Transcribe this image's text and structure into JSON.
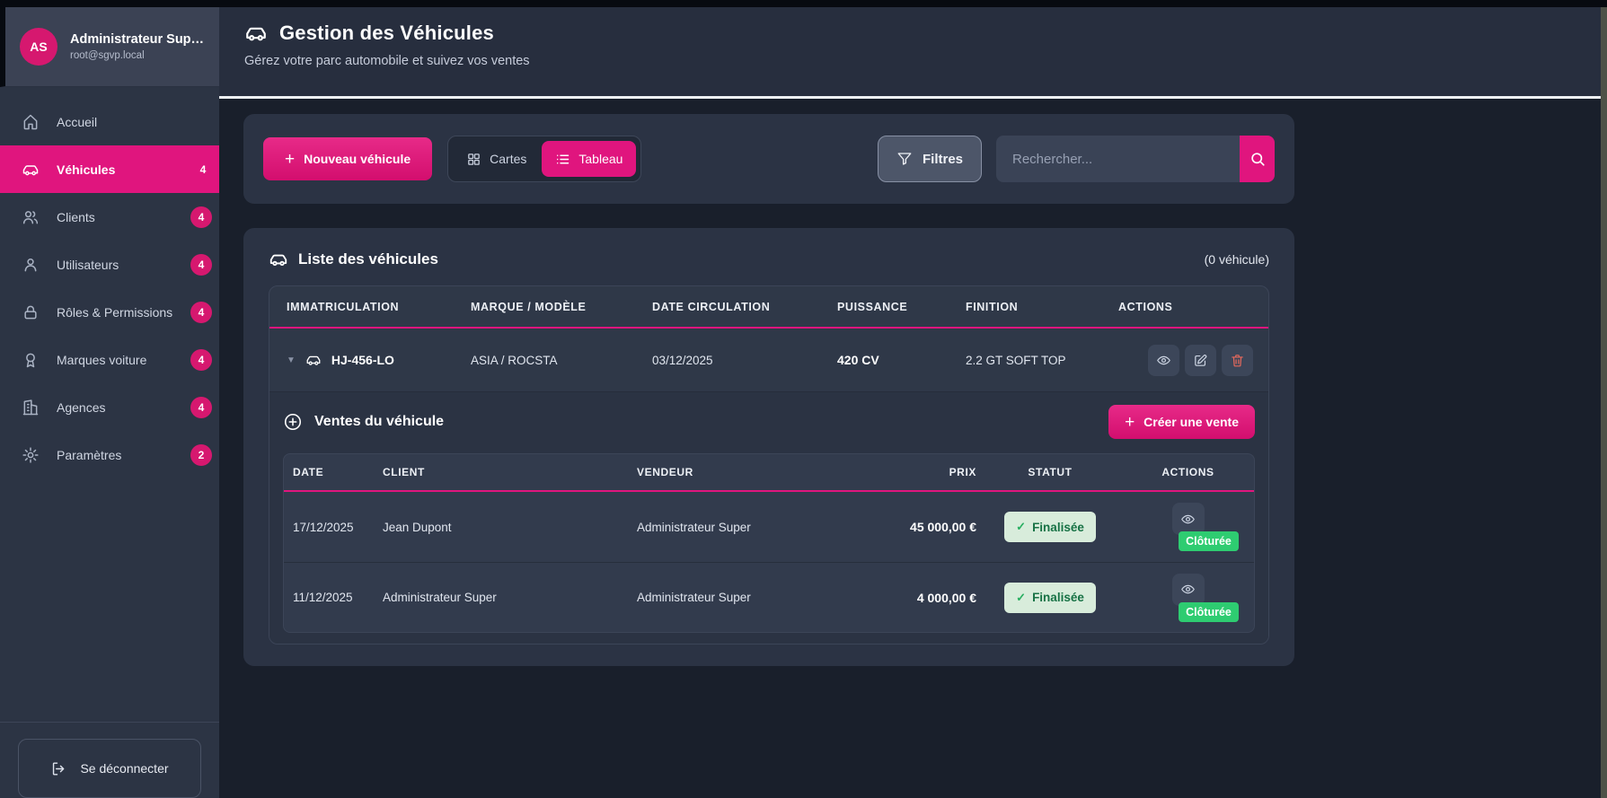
{
  "colors": {
    "accent": "#e0157e",
    "success": "#2ecc71",
    "danger": "#e8695c"
  },
  "sidebar": {
    "user": {
      "initials": "AS",
      "name": "Administrateur Sup…",
      "email": "root@sgvp.local"
    },
    "items": [
      {
        "label": "Accueil",
        "badge": ""
      },
      {
        "label": "Véhicules",
        "badge": "4"
      },
      {
        "label": "Clients",
        "badge": "4"
      },
      {
        "label": "Utilisateurs",
        "badge": "4"
      },
      {
        "label": "Rôles & Permissions",
        "badge": "4"
      },
      {
        "label": "Marques voiture",
        "badge": "4"
      },
      {
        "label": "Agences",
        "badge": "4"
      },
      {
        "label": "Paramètres",
        "badge": "2"
      }
    ],
    "logout_label": "Se déconnecter"
  },
  "header": {
    "title": "Gestion des Véhicules",
    "subtitle": "Gérez votre parc automobile et suivez vos ventes"
  },
  "toolbar": {
    "new_vehicle_label": "Nouveau véhicule",
    "view_cards_label": "Cartes",
    "view_table_label": "Tableau",
    "filters_label": "Filtres",
    "search_placeholder": "Rechercher..."
  },
  "vehicles": {
    "card_title": "Liste des véhicules",
    "count_label": "(0 véhicule)",
    "columns": [
      "IMMATRICULATION",
      "MARQUE / MODÈLE",
      "DATE CIRCULATION",
      "PUISSANCE",
      "FINITION",
      "ACTIONS"
    ],
    "rows": [
      {
        "immatriculation": "HJ-456-LO",
        "marque_modele": "ASIA / ROCSTA",
        "date_circulation": "03/12/2025",
        "puissance": "420 CV",
        "finition": "2.2 GT SOFT TOP"
      }
    ]
  },
  "sales": {
    "section_title": "Ventes du véhicule",
    "create_sale_label": "Créer une vente",
    "columns": [
      "DATE",
      "CLIENT",
      "VENDEUR",
      "PRIX",
      "STATUT",
      "ACTIONS"
    ],
    "rows": [
      {
        "date": "17/12/2025",
        "client": "Jean Dupont",
        "vendeur": "Administrateur Super",
        "prix": "45 000,00 €",
        "statut": "Finalisée",
        "etat": "Clôturée"
      },
      {
        "date": "11/12/2025",
        "client": "Administrateur Super",
        "vendeur": "Administrateur Super",
        "prix": "4 000,00 €",
        "statut": "Finalisée",
        "etat": "Clôturée"
      }
    ]
  }
}
